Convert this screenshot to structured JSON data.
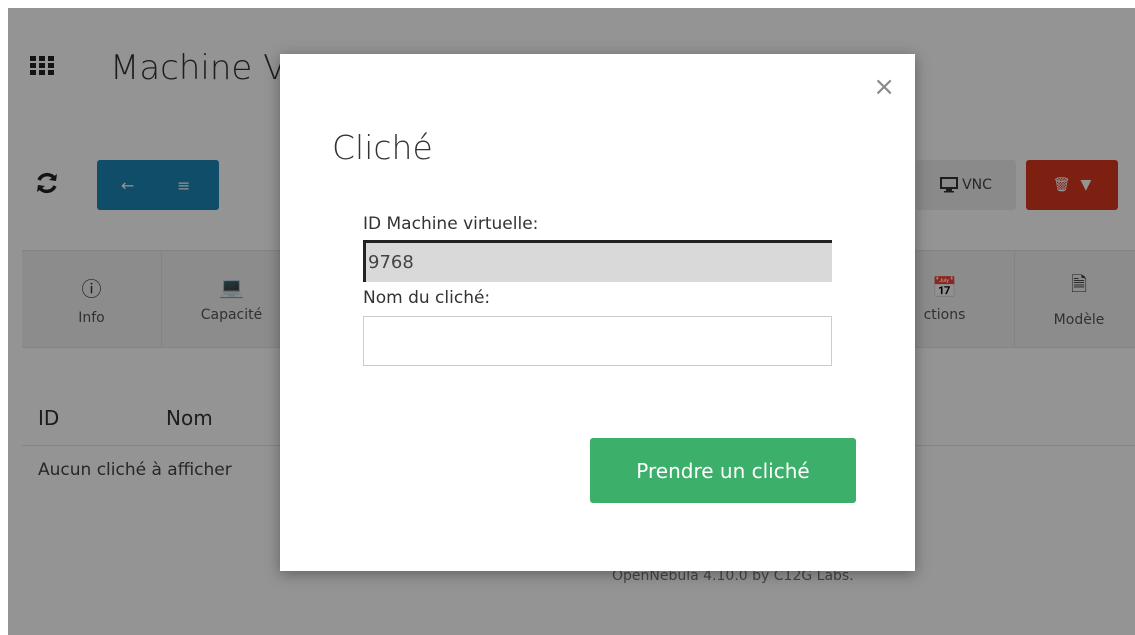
{
  "page": {
    "title": "Machine V",
    "vnc_label": "VNC",
    "tabs": [
      {
        "label": "Info",
        "icon": "info-icon"
      },
      {
        "label": "Capacité",
        "icon": "laptop-icon"
      },
      {
        "label": "ctions",
        "icon": "calendar-icon"
      },
      {
        "label": "Modèle",
        "icon": "file-icon"
      }
    ],
    "table": {
      "headers": [
        "ID",
        "Nom"
      ],
      "empty_message": "Aucun cliché à afficher"
    },
    "footer": "OpenNebula 4.10.0 by C12G Labs."
  },
  "modal": {
    "title": "Cliché",
    "close_label": "×",
    "vm_id_label": "ID Machine virtuelle:",
    "vm_id_value": "9768",
    "snapshot_name_label": "Nom du cliché:",
    "snapshot_name_value": "",
    "submit_label": "Prendre un cliché"
  },
  "colors": {
    "primary": "#1b86b4",
    "danger": "#d9381e",
    "success": "#3cb06a"
  }
}
